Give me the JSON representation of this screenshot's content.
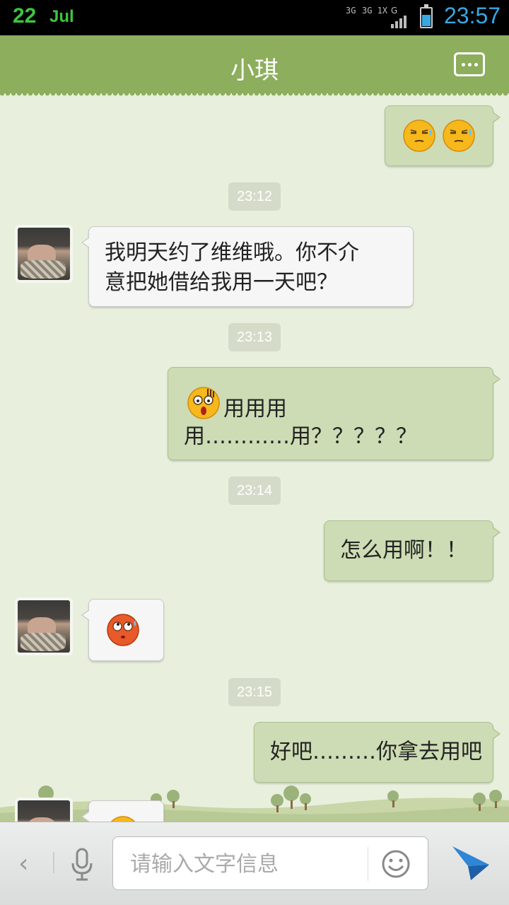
{
  "status_bar": {
    "date_day": "22",
    "date_month": "Jul",
    "network_1": "3G",
    "network_2": "3G 1X",
    "network_3": "G",
    "time": "23:57"
  },
  "header": {
    "title": "小琪"
  },
  "messages": {
    "m1_emoji": "sweat-smile-emoji",
    "ts1": "23:12",
    "m2_text": "我明天约了维维哦。你不介\n意把她借给我用一天吧？",
    "ts2": "23:13",
    "m3_text_line1": "用用用",
    "m3_text_line2": "用…………用？？？？？",
    "ts3": "23:14",
    "m4_text": "怎么用啊！！",
    "m5_emoji": "rolling-eyes-emoji",
    "ts4": "23:15",
    "m6_text": "好吧………你拿去用吧"
  },
  "input_bar": {
    "back_icon": "‹",
    "placeholder": "请输入文字信息"
  },
  "colors": {
    "header": "#8dae5c",
    "chat_bg": "#e8efdc",
    "right_bubble": "#cddcb4",
    "left_bubble": "#f6f6f6",
    "time_blue": "#39a7e4",
    "date_green": "#3ec43e"
  }
}
